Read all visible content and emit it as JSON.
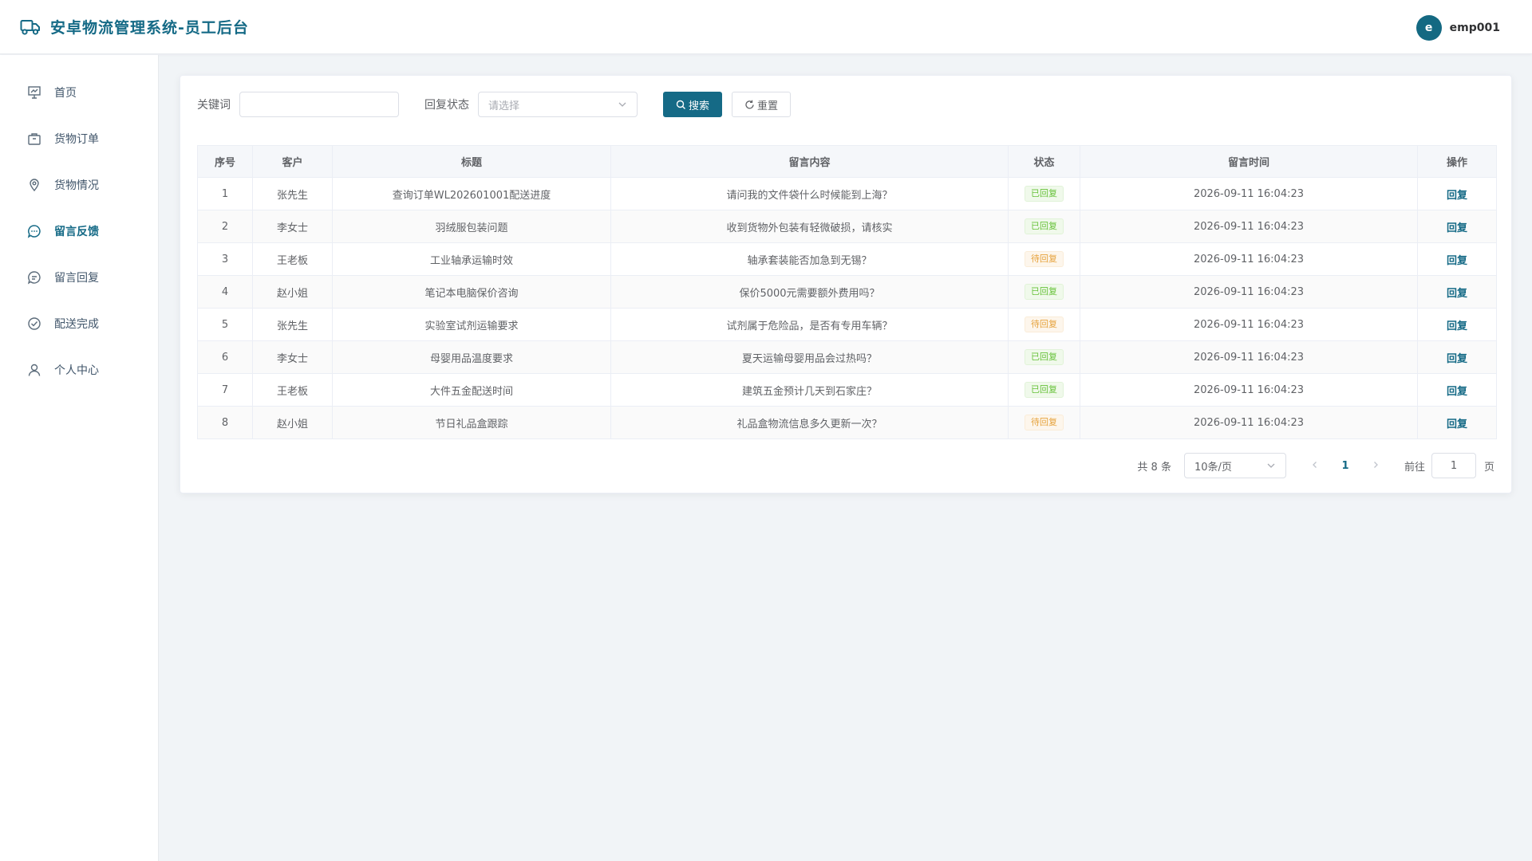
{
  "app": {
    "title": "安卓物流管理系统-员工后台",
    "user": {
      "avatar_letter": "e",
      "name": "emp001"
    }
  },
  "colors": {
    "brand": "#156a86",
    "success": "#67c23a",
    "warning": "#e6a23c"
  },
  "sidebar": {
    "items": [
      {
        "label": "首页",
        "icon": "dashboard-icon",
        "active": false
      },
      {
        "label": "货物订单",
        "icon": "package-icon",
        "active": false
      },
      {
        "label": "货物情况",
        "icon": "location-pin-icon",
        "active": false
      },
      {
        "label": "留言反馈",
        "icon": "chat-bubble-icon",
        "active": true
      },
      {
        "label": "留言回复",
        "icon": "reply-bubble-icon",
        "active": false
      },
      {
        "label": "配送完成",
        "icon": "check-circle-icon",
        "active": false
      },
      {
        "label": "个人中心",
        "icon": "user-icon",
        "active": false
      }
    ]
  },
  "search": {
    "keyword_label": "关键词",
    "keyword_value": "",
    "status_label": "回复状态",
    "status_placeholder": "请选择",
    "search_button": "搜索",
    "reset_button": "重置"
  },
  "table": {
    "columns": [
      "序号",
      "客户",
      "标题",
      "留言内容",
      "状态",
      "留言时间",
      "操作"
    ],
    "rows": [
      {
        "index": "1",
        "customer": "张先生",
        "title": "查询订单WL202601001配送进度",
        "content": "请问我的文件袋什么时候能到上海？",
        "status": "已回复",
        "status_type": "success",
        "time": "2026-09-11 16:04:23",
        "action": "回复"
      },
      {
        "index": "2",
        "customer": "李女士",
        "title": "羽绒服包装问题",
        "content": "收到货物外包装有轻微破损，请核实",
        "status": "已回复",
        "status_type": "success",
        "time": "2026-09-11 16:04:23",
        "action": "回复"
      },
      {
        "index": "3",
        "customer": "王老板",
        "title": "工业轴承运输时效",
        "content": "轴承套装能否加急到无锡？",
        "status": "待回复",
        "status_type": "warning",
        "time": "2026-09-11 16:04:23",
        "action": "回复"
      },
      {
        "index": "4",
        "customer": "赵小姐",
        "title": "笔记本电脑保价咨询",
        "content": "保价5000元需要额外费用吗？",
        "status": "已回复",
        "status_type": "success",
        "time": "2026-09-11 16:04:23",
        "action": "回复"
      },
      {
        "index": "5",
        "customer": "张先生",
        "title": "实验室试剂运输要求",
        "content": "试剂属于危险品，是否有专用车辆？",
        "status": "待回复",
        "status_type": "warning",
        "time": "2026-09-11 16:04:23",
        "action": "回复"
      },
      {
        "index": "6",
        "customer": "李女士",
        "title": "母婴用品温度要求",
        "content": "夏天运输母婴用品会过热吗？",
        "status": "已回复",
        "status_type": "success",
        "time": "2026-09-11 16:04:23",
        "action": "回复"
      },
      {
        "index": "7",
        "customer": "王老板",
        "title": "大件五金配送时间",
        "content": "建筑五金预计几天到石家庄？",
        "status": "已回复",
        "status_type": "success",
        "time": "2026-09-11 16:04:23",
        "action": "回复"
      },
      {
        "index": "8",
        "customer": "赵小姐",
        "title": "节日礼品盒跟踪",
        "content": "礼品盒物流信息多久更新一次？",
        "status": "待回复",
        "status_type": "warning",
        "time": "2026-09-11 16:04:23",
        "action": "回复"
      }
    ]
  },
  "pagination": {
    "total_text": "共 8 条",
    "page_size": "10条/页",
    "current_page": "1",
    "goto_label": "前往",
    "goto_value": "1",
    "page_suffix": "页"
  }
}
